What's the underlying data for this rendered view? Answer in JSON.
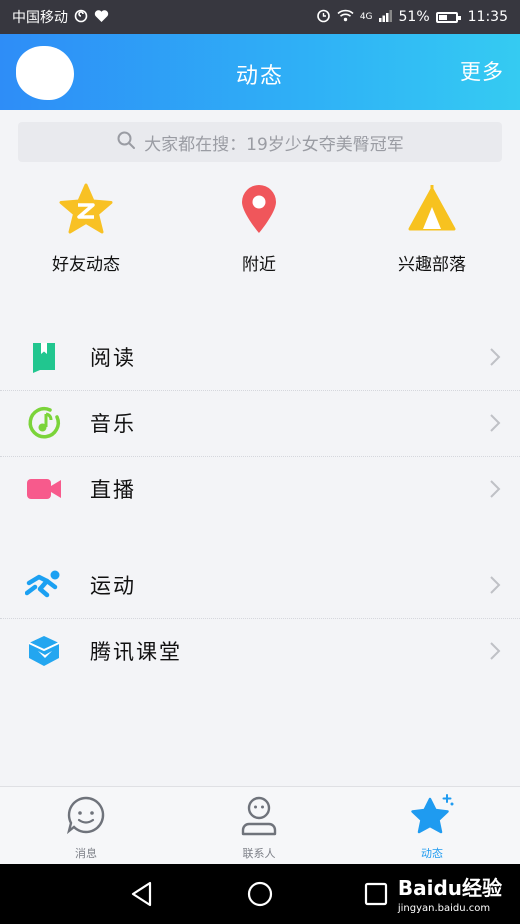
{
  "status_bar": {
    "carrier": "中国移动",
    "network": "4G",
    "battery": "51%",
    "time": "11:35"
  },
  "header": {
    "title": "动态",
    "more": "更多"
  },
  "search": {
    "placeholder": "大家都在搜：19岁少女夺美臀冠军"
  },
  "quick_entries": [
    {
      "label": "好友动态",
      "icon": "qzone-star-icon",
      "color": "#f8c124"
    },
    {
      "label": "附近",
      "icon": "location-pin-icon",
      "color": "#f0565b"
    },
    {
      "label": "兴趣部落",
      "icon": "tent-icon",
      "color": "#f7c21f"
    }
  ],
  "list_group_1": [
    {
      "label": "阅读",
      "icon": "book-icon",
      "color": "#21c68f"
    },
    {
      "label": "音乐",
      "icon": "music-icon",
      "color": "#7bd43a"
    },
    {
      "label": "直播",
      "icon": "video-camera-icon",
      "color": "#f75a8c"
    }
  ],
  "list_group_2": [
    {
      "label": "运动",
      "icon": "running-icon",
      "color": "#1ba0f2"
    },
    {
      "label": "腾讯课堂",
      "icon": "classroom-icon",
      "color": "#23a6f0"
    }
  ],
  "tabbar": [
    {
      "label": "消息",
      "icon": "chat-bubble-icon",
      "active": false
    },
    {
      "label": "联系人",
      "icon": "contacts-icon",
      "active": false
    },
    {
      "label": "动态",
      "icon": "star-icon",
      "active": true
    }
  ],
  "watermark": {
    "brand": "Baidu经验",
    "url": "jingyan.baidu.com"
  },
  "colors": {
    "header_start": "#2e8df7",
    "header_end": "#35cbf2",
    "active_tab": "#1f9bf0"
  }
}
